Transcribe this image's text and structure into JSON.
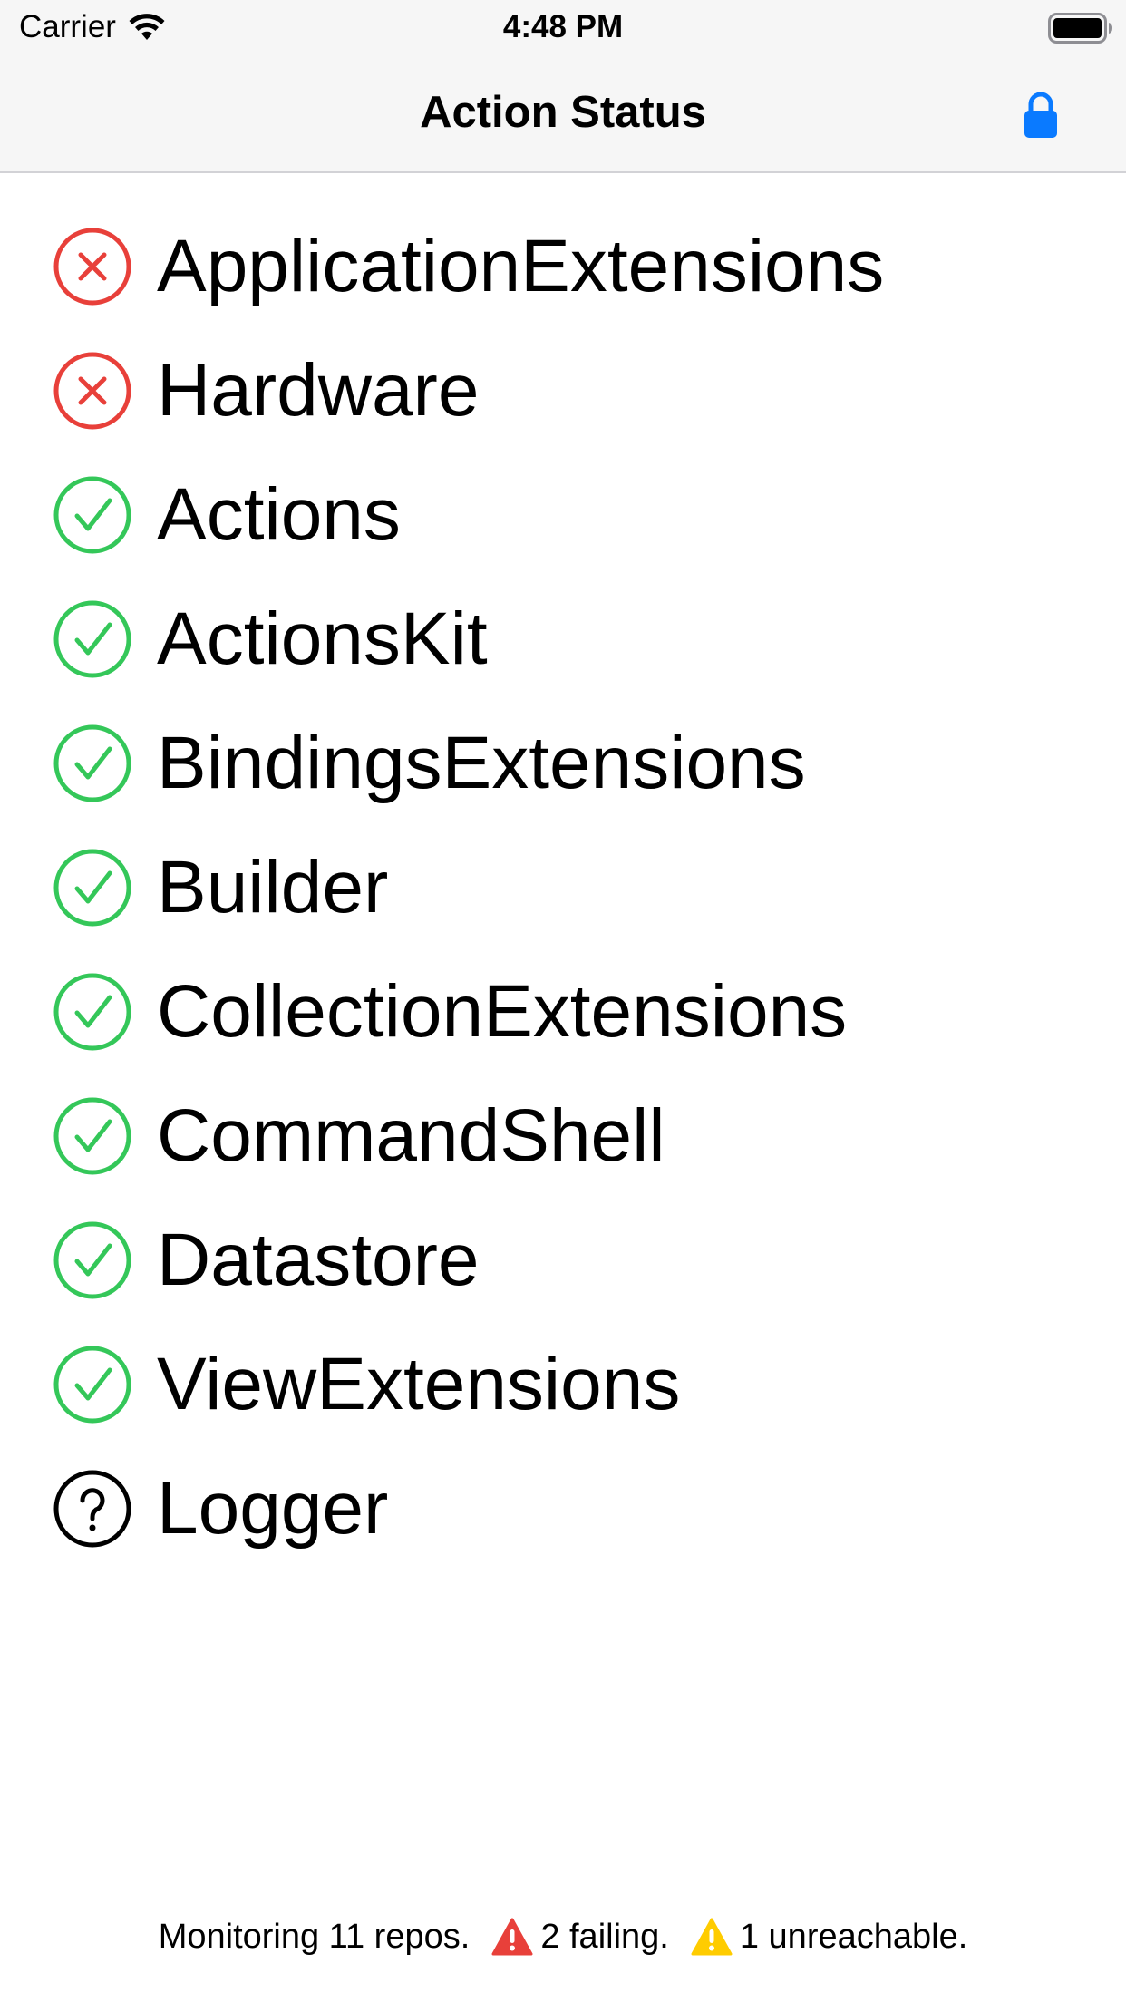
{
  "status_bar": {
    "carrier": "Carrier",
    "time": "4:48 PM",
    "wifi_icon": "wifi-icon",
    "battery_icon": "battery-icon"
  },
  "nav": {
    "title": "Action Status",
    "lock_icon": "lock-icon",
    "accent_color": "#0a7aff"
  },
  "colors": {
    "failing": "#e8403a",
    "passing": "#34c759",
    "unknown": "#000000",
    "warning_yellow": "#ffcc00"
  },
  "repos": [
    {
      "name": "ApplicationExtensions",
      "status": "failing",
      "icon": "x-circle-icon"
    },
    {
      "name": "Hardware",
      "status": "failing",
      "icon": "x-circle-icon"
    },
    {
      "name": "Actions",
      "status": "passing",
      "icon": "checkmark-circle-icon"
    },
    {
      "name": "ActionsKit",
      "status": "passing",
      "icon": "checkmark-circle-icon"
    },
    {
      "name": "BindingsExtensions",
      "status": "passing",
      "icon": "checkmark-circle-icon"
    },
    {
      "name": "Builder",
      "status": "passing",
      "icon": "checkmark-circle-icon"
    },
    {
      "name": "CollectionExtensions",
      "status": "passing",
      "icon": "checkmark-circle-icon"
    },
    {
      "name": "CommandShell",
      "status": "passing",
      "icon": "checkmark-circle-icon"
    },
    {
      "name": "Datastore",
      "status": "passing",
      "icon": "checkmark-circle-icon"
    },
    {
      "name": "ViewExtensions",
      "status": "passing",
      "icon": "checkmark-circle-icon"
    },
    {
      "name": "Logger",
      "status": "unknown",
      "icon": "question-circle-icon"
    }
  ],
  "footer": {
    "monitoring": "Monitoring 11 repos.",
    "failing": "2 failing.",
    "unreachable": "1 unreachable.",
    "failing_icon": "warning-triangle-red-icon",
    "unreachable_icon": "warning-triangle-yellow-icon"
  }
}
